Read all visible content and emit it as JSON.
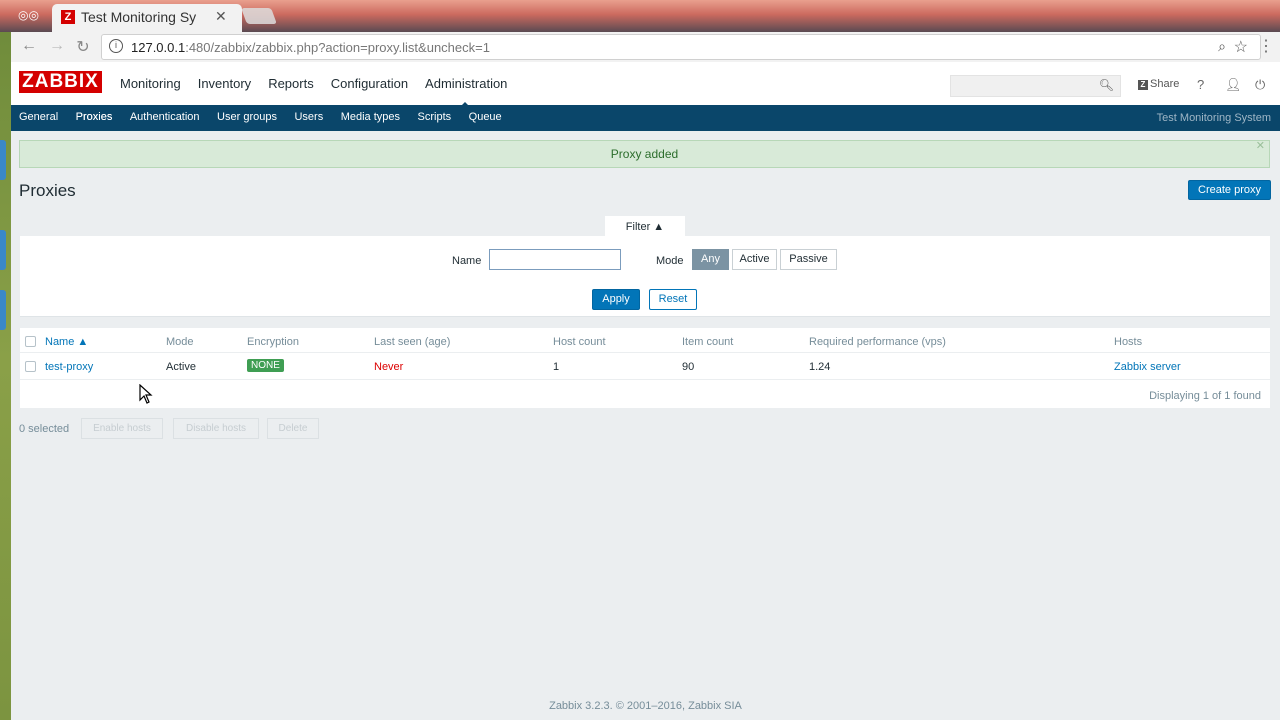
{
  "browser": {
    "tab_title": "Test Monitoring Sy",
    "url_host": "127.0.0.1",
    "url_rest": ":480/zabbix/zabbix.php?action=proxy.list&uncheck=1"
  },
  "header": {
    "logo": "ZABBIX",
    "nav": [
      "Monitoring",
      "Inventory",
      "Reports",
      "Configuration",
      "Administration"
    ],
    "share": "Share",
    "help": "?"
  },
  "subnav": {
    "items": [
      "General",
      "Proxies",
      "Authentication",
      "User groups",
      "Users",
      "Media types",
      "Scripts",
      "Queue"
    ],
    "server_name": "Test Monitoring System"
  },
  "message": "Proxy added",
  "page_title": "Proxies",
  "create_button": "Create proxy",
  "filter": {
    "tab_label": "Filter ▲",
    "name_label": "Name",
    "name_value": "",
    "mode_label": "Mode",
    "mode_options": [
      "Any",
      "Active",
      "Passive"
    ],
    "mode_selected": "Any",
    "apply": "Apply",
    "reset": "Reset"
  },
  "table": {
    "columns": [
      "Name ▲",
      "Mode",
      "Encryption",
      "Last seen (age)",
      "Host count",
      "Item count",
      "Required performance (vps)",
      "Hosts"
    ],
    "rows": [
      {
        "name": "test-proxy",
        "mode": "Active",
        "encryption": "NONE",
        "last_seen": "Never",
        "host_count": "1",
        "item_count": "90",
        "required_performance": "1.24",
        "hosts": "Zabbix server"
      }
    ],
    "displaying": "Displaying 1 of 1 found"
  },
  "mass_actions": {
    "selected": "0 selected",
    "buttons": [
      "Enable hosts",
      "Disable hosts",
      "Delete"
    ]
  },
  "footer": {
    "text": "Zabbix 3.2.3. © 2001–2016,",
    "company": "Zabbix SIA"
  }
}
